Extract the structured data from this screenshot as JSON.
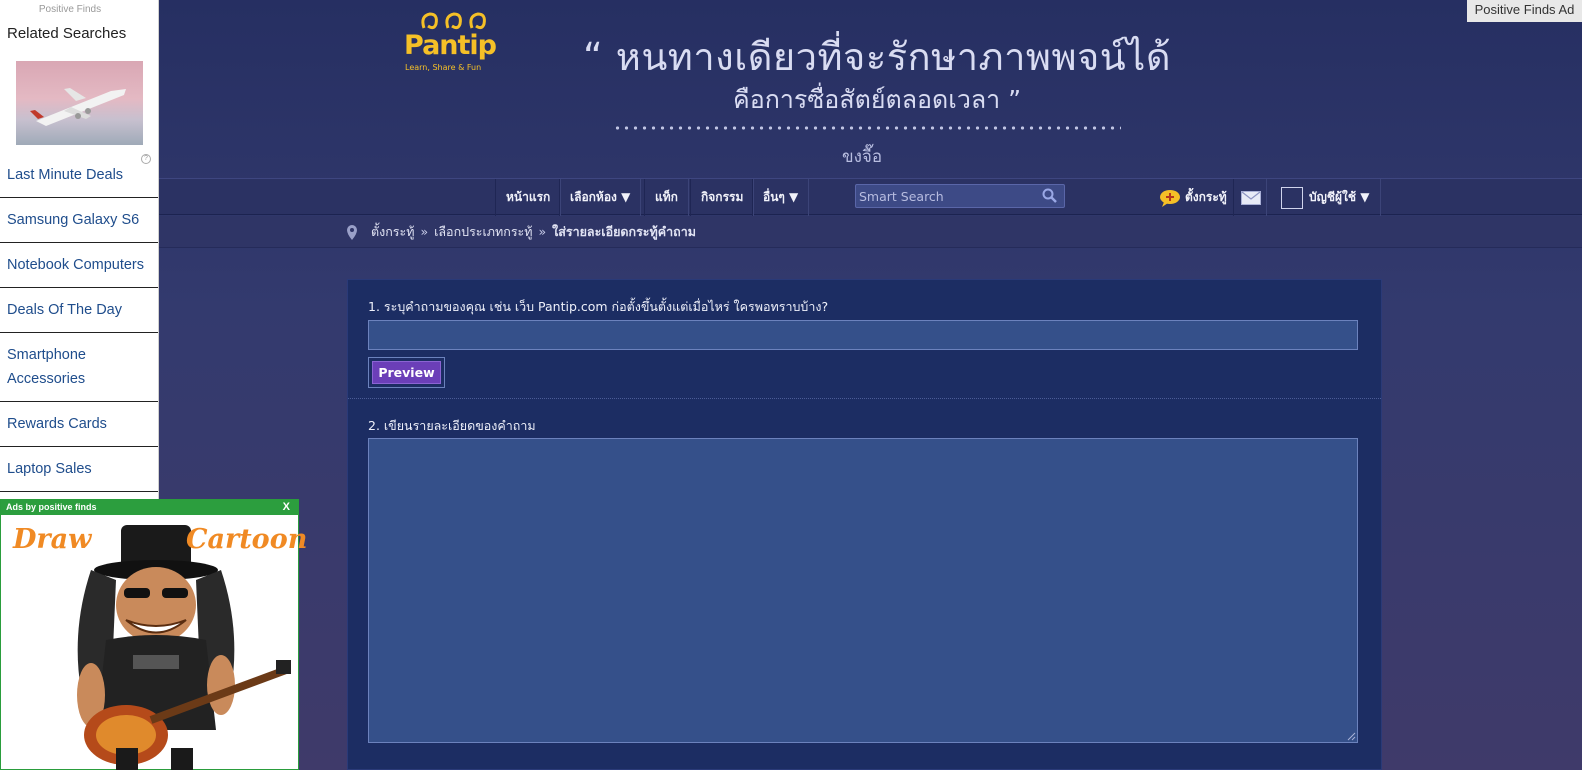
{
  "sidebar": {
    "small_label": "Positive Finds",
    "heading": "Related Searches",
    "links": [
      "Last Minute Deals",
      "Samsung Galaxy S6",
      "Notebook Computers",
      "Deals Of The Day",
      "Smartphone Accessories",
      "Rewards Cards",
      "Laptop Sales"
    ]
  },
  "adbox": {
    "bar_label": "Ads by positive finds",
    "close": "X",
    "caption_left": "Draw",
    "caption_right": "Cartoon"
  },
  "top_right_tag": "Positive Finds Ad",
  "header": {
    "logo_word": "Pantip",
    "logo_tagline": "Learn, Share & Fun",
    "quote_line1": "“ หนทางเดียวที่จะรักษาภาพพจน์ได้",
    "quote_line2": "คือการซื่อสัตย์ตลอดเวลา ”",
    "quote_author": "ขงจื๊อ"
  },
  "nav": {
    "items": [
      "หน้าแรก",
      "เลือกห้อง ▼",
      "แท็ก",
      "กิจกรรม",
      "อื่นๆ ▼"
    ],
    "search_placeholder": "Smart Search",
    "post_label": "ตั้งกระทู้",
    "account_label": "บัญชีผู้ใช้ ▼"
  },
  "breadcrumb": {
    "items": [
      "ตั้งกระทู้",
      "เลือกประเภทกระทู้",
      "ใส่รายละเอียดกระทู้คำถาม"
    ],
    "separator": "»"
  },
  "form": {
    "q1_label": "1. ระบุคำถามของคุณ เช่น เว็บ Pantip.com ก่อตั้งขึ้นตั้งแต่เมื่อไหร่ ใครพอทราบบ้าง?",
    "title_value": "",
    "preview_label": "Preview",
    "q2_label": "2. เขียนรายละเอียดของคำถาม",
    "detail_value": ""
  },
  "colors": {
    "background": "#2c3466",
    "panel": "#1c2d63",
    "input": "#35508a",
    "preview_button": "#6b3fb8",
    "logo": "#f5c027",
    "ad_green": "#2c9e3e",
    "ad_caption": "#f08a24"
  },
  "icons": {
    "search": "magnifier-icon",
    "post": "speech-bubble-plus-icon",
    "mail": "envelope-icon",
    "breadcrumb": "location-pin-icon"
  }
}
